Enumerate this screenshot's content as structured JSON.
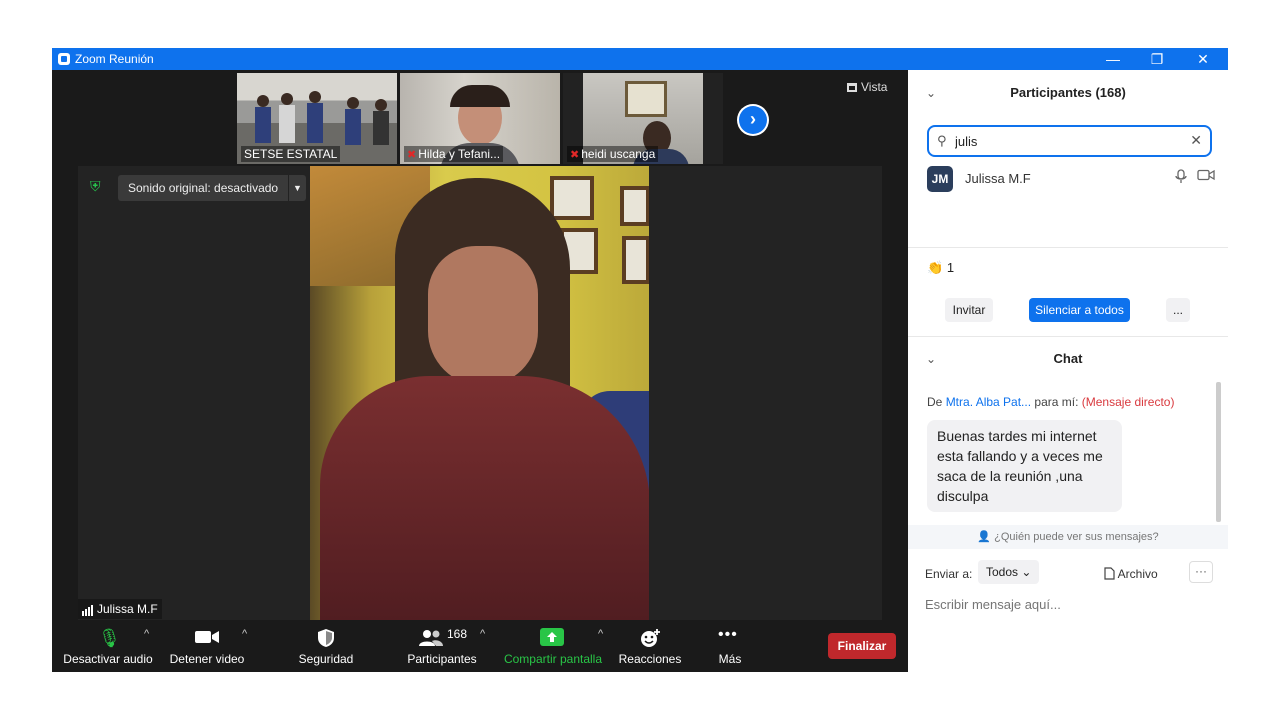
{
  "window": {
    "title": "Zoom Reunión",
    "controls": {
      "minimize": "—",
      "restore": "❐",
      "close": "✕"
    }
  },
  "gallery": {
    "thumbnails": [
      {
        "name": "SETSE ESTATAL",
        "muted": false
      },
      {
        "name": "Hilda y Tefani...",
        "muted": true
      },
      {
        "name": "heidi uscanga",
        "muted": true
      }
    ],
    "next_icon": "chevron-right-icon",
    "view_label": "Vista"
  },
  "main_video": {
    "sound_button_label": "Sonido original: desactivado",
    "speaker_name": "Julissa M.F"
  },
  "toolbar": {
    "audio_label": "Desactivar audio",
    "video_label": "Detener video",
    "security_label": "Seguridad",
    "participants_label": "Participantes",
    "participants_count": "168",
    "share_label": "Compartir pantalla",
    "reactions_label": "Reacciones",
    "more_label": "Más",
    "end_label": "Finalizar"
  },
  "participants_panel": {
    "title": "Participantes (168)",
    "search_value": "julis",
    "results": [
      {
        "initials": "JM",
        "name": "Julissa M.F"
      }
    ],
    "reaction_count": "1",
    "invite_label": "Invitar",
    "mute_all_label": "Silenciar a todos",
    "more_label": "..."
  },
  "chat_panel": {
    "title": "Chat",
    "message": {
      "prefix": "De",
      "sender": "Mtra. Alba Pat...",
      "to": "para mí:",
      "type": "(Mensaje directo)",
      "text": "Buenas tardes mi internet esta fallando y a veces me saca de la reunión ,una disculpa"
    },
    "who_sees": "¿Quién puede ver sus mensajes?",
    "send_to_label": "Enviar a:",
    "recipient": "Todos",
    "file_label": "Archivo",
    "more_label": "···",
    "input_placeholder": "Escribir mensaje aquí..."
  },
  "colors": {
    "accent": "#0e72ed",
    "end_button": "#c0282c",
    "share_green": "#29c547"
  }
}
